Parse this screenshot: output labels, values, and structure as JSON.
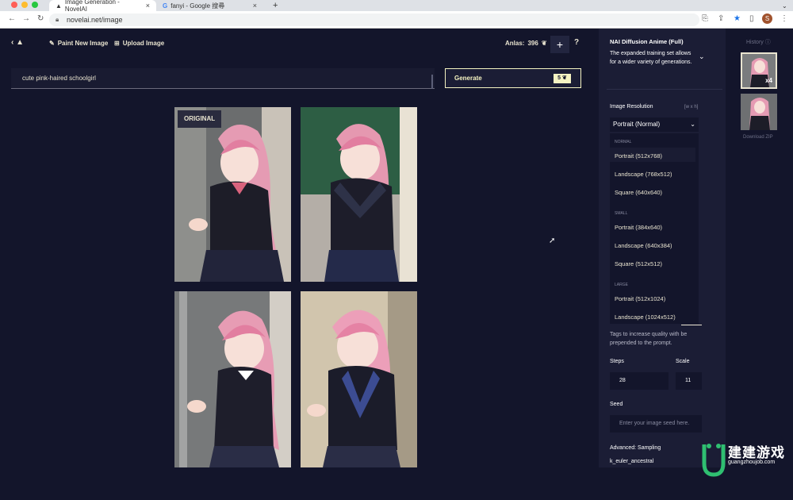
{
  "browser": {
    "tabs": [
      {
        "title": "Image Generation - NovelAI",
        "active": true
      },
      {
        "title": "fanyi - Google 搜尋",
        "active": false
      }
    ],
    "url": "novelai.net/image",
    "profile_initial": "S"
  },
  "header": {
    "paint_label": "Paint New Image",
    "upload_label": "Upload Image",
    "anlas_label": "Anlas:",
    "anlas_value": "396",
    "plus_label": "+",
    "help_label": "?"
  },
  "prompt": {
    "value": "cute pink-haired schoolgirl"
  },
  "generate": {
    "label": "Generate",
    "cost": "5"
  },
  "gallery": {
    "original_badge": "ORIGINAL"
  },
  "settings": {
    "model_name": "NAI Diffusion Anime (Full)",
    "model_desc": "The expanded training set allows for a wider variety of generations.",
    "resolution_label": "Image Resolution",
    "resolution_hint": "[w x h]",
    "resolution_value": "Portrait (Normal)",
    "groups": [
      {
        "name": "NORMAL",
        "options": [
          "Portrait (512x768)",
          "Landscape (768x512)",
          "Square (640x640)"
        ]
      },
      {
        "name": "SMALL",
        "options": [
          "Portrait (384x640)",
          "Landscape (640x384)",
          "Square (512x512)"
        ]
      },
      {
        "name": "LARGE",
        "options": [
          "Portrait (512x1024)",
          "Landscape (1024x512)"
        ]
      }
    ],
    "quality_hint": "Tags to increase quality with be prepended to the prompt.",
    "steps_label": "Steps",
    "steps_value": "28",
    "scale_label": "Scale",
    "scale_value": "11",
    "seed_label": "Seed",
    "seed_placeholder": "Enter your image seed here.",
    "sampling_label": "Advanced: Sampling",
    "sampling_value": "k_euler_ancestral"
  },
  "history": {
    "label": "History",
    "badge": "x4",
    "download_label": "Download ZIP"
  },
  "watermark": {
    "line1": "建建游戏",
    "line2": "guangzhoujob.com"
  },
  "colors": {
    "bg": "#13152b",
    "panel": "#1b1d35",
    "accent": "#f5f3c2",
    "text": "#e9e4d0"
  }
}
